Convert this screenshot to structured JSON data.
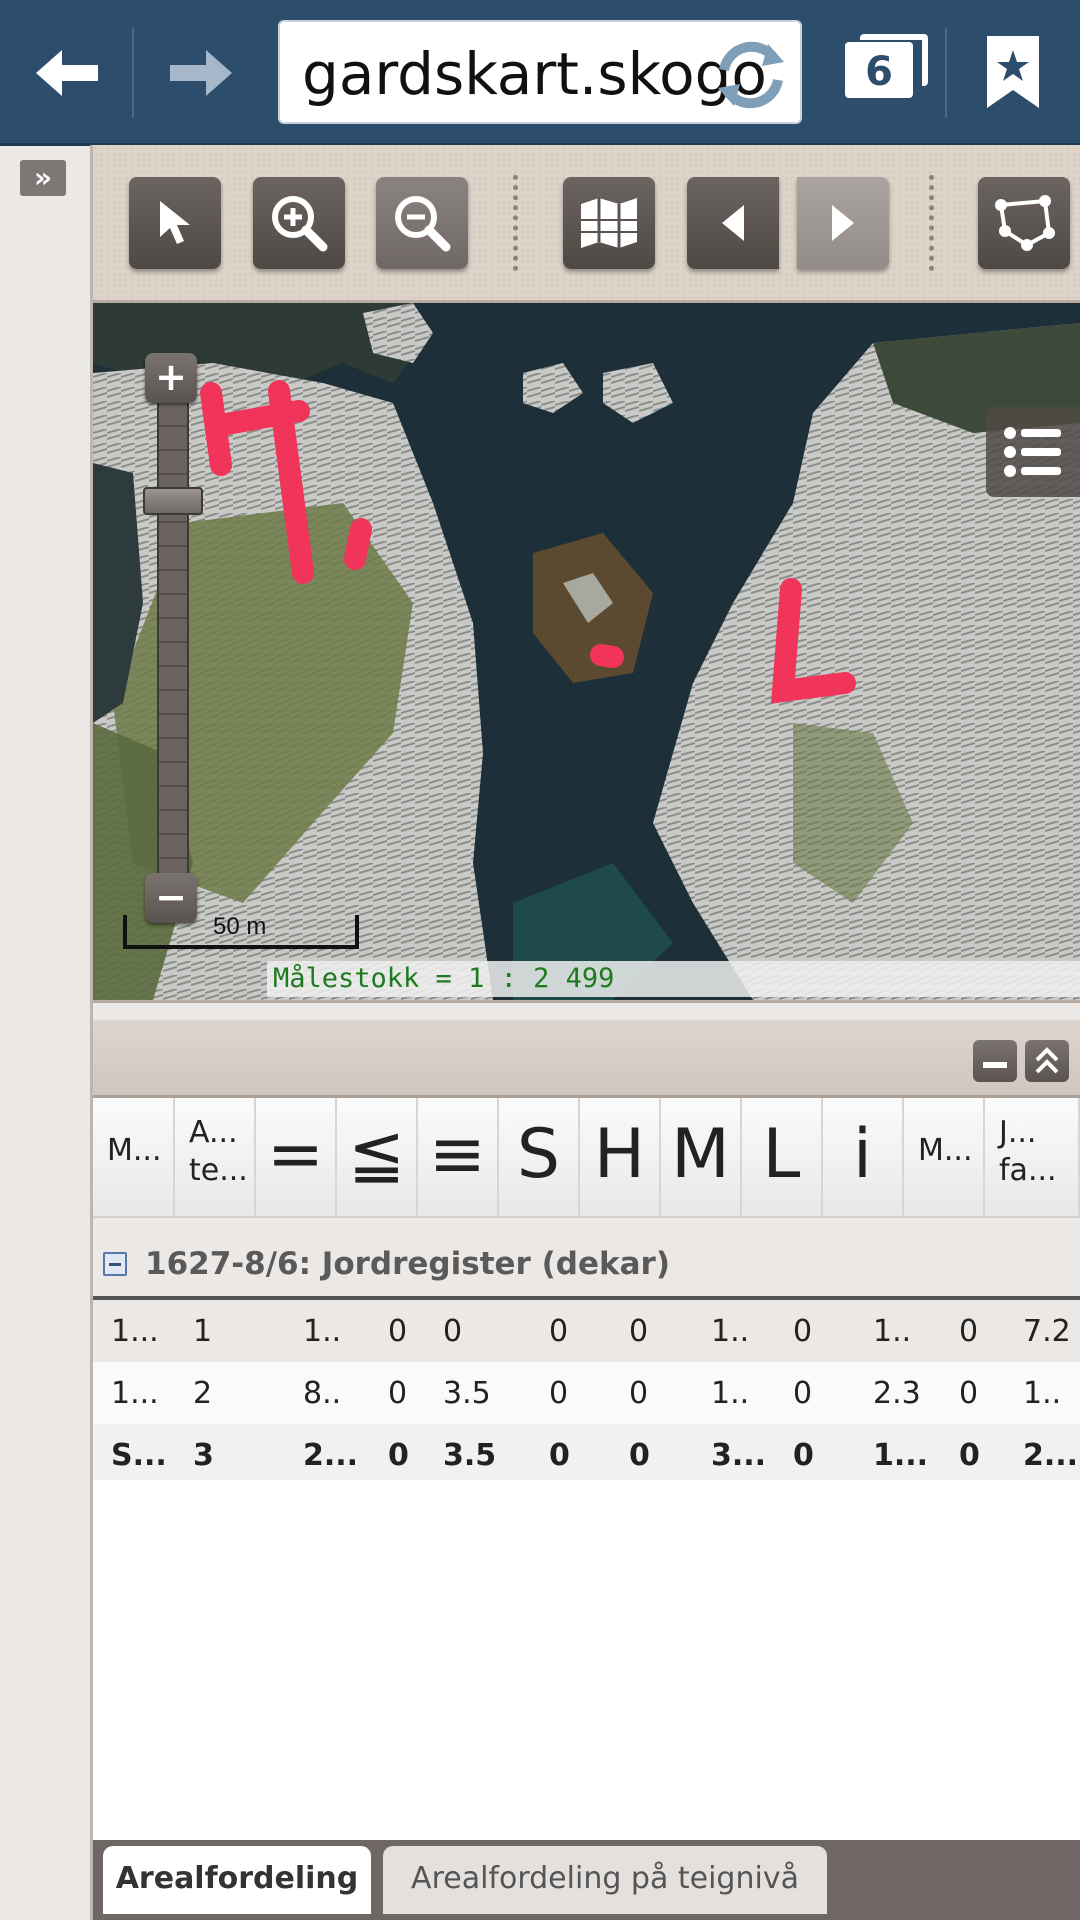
{
  "browser": {
    "url": "gardskart.skogo",
    "tab_count": "6"
  },
  "toolbar": {
    "tools": [
      "select-arrow",
      "zoom-in",
      "zoom-out",
      "map-overview",
      "previous-extent",
      "next-extent",
      "draw-polygon"
    ]
  },
  "map": {
    "annotations": [
      "H",
      "L"
    ],
    "scalebar_label": "50 m",
    "scale_ratio": "Målestokk = 1 : 2 499",
    "zoom_level_fraction": 0.2
  },
  "grid": {
    "columns": [
      {
        "label": "M..."
      },
      {
        "label": "A...\nte..."
      },
      {
        "label": "="
      },
      {
        "label": "≦"
      },
      {
        "label": "≡"
      },
      {
        "label": "S"
      },
      {
        "label": "H"
      },
      {
        "label": "M"
      },
      {
        "label": "L"
      },
      {
        "label": "i"
      },
      {
        "label": "M..."
      },
      {
        "label": "J...\nfa..."
      }
    ],
    "group_title": "1627-8/6: Jordregister (dekar)",
    "rows": [
      [
        "1...",
        "1",
        "1..",
        "0",
        "0",
        "0",
        "0",
        "1..",
        "0",
        "1..",
        "0",
        "7.2"
      ],
      [
        "1...",
        "2",
        "8..",
        "0",
        "3.5",
        "0",
        "0",
        "1..",
        "0",
        "2.3",
        "0",
        "1.."
      ],
      [
        "S...",
        "3",
        "2...",
        "0",
        "3.5",
        "0",
        "0",
        "3...",
        "0",
        "1...",
        "0",
        "2..."
      ]
    ]
  },
  "tabs": {
    "active": "Arealfordeling",
    "inactive": "Arealfordeling på teignivå"
  },
  "colors": {
    "topbar": "#2d4d6c",
    "annotation": "#f0345a",
    "scale_text": "#1e7a1e"
  }
}
